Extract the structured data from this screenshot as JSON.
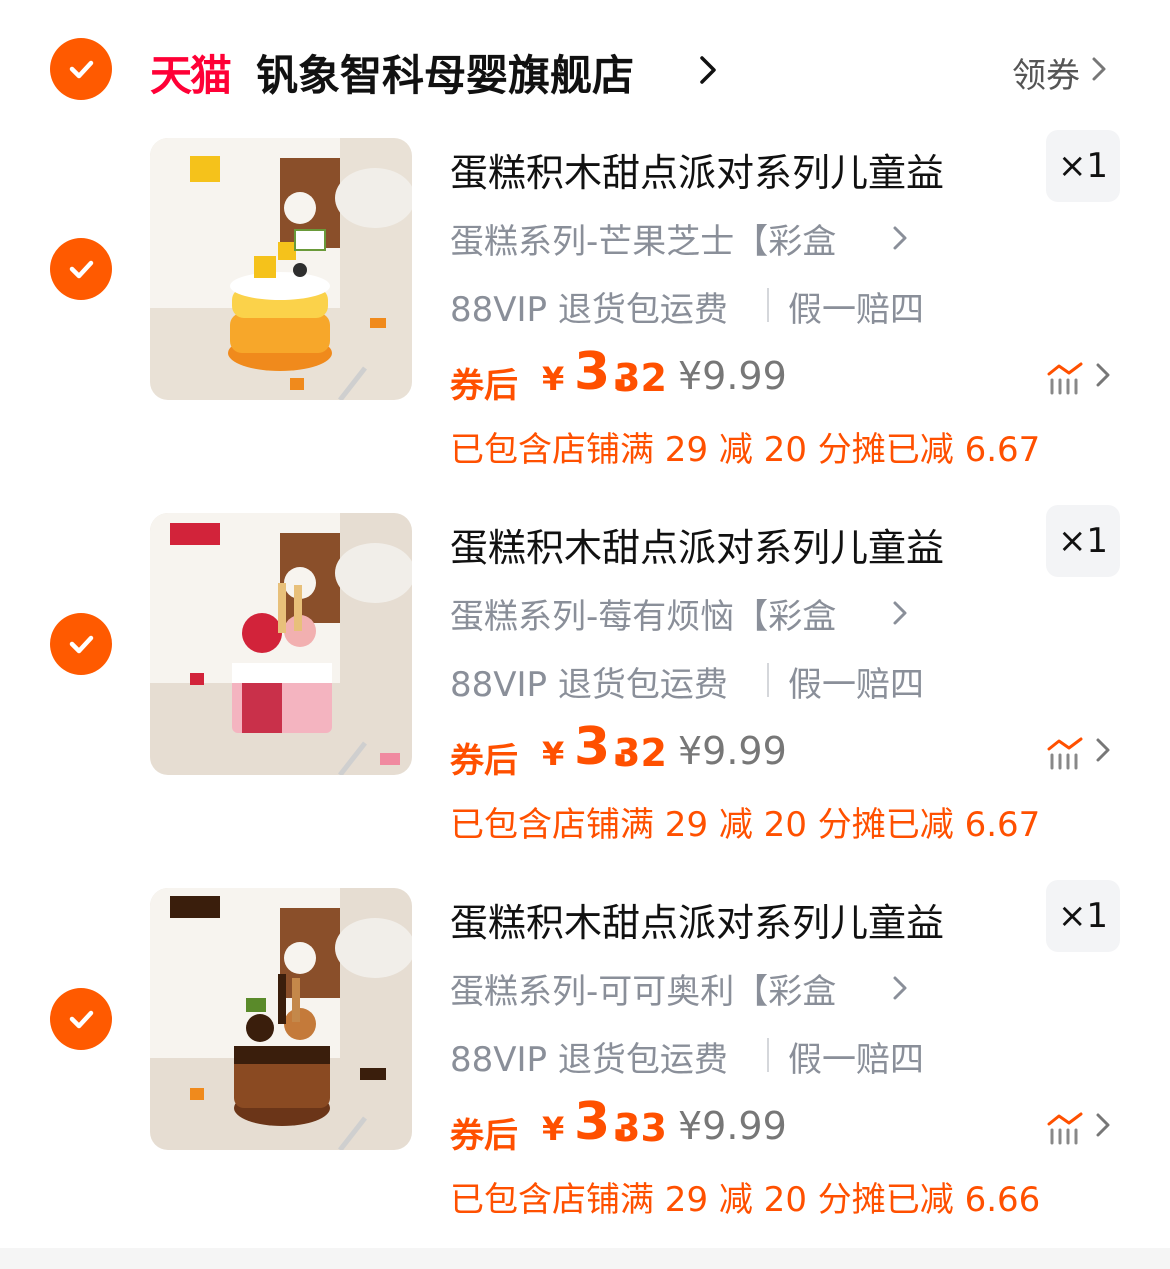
{
  "shop": {
    "brand": "天猫",
    "name": "钒象智科母婴旗舰店",
    "coupon_label": "领券",
    "checked": true
  },
  "colors": {
    "accent": "#ff5a00",
    "price": "#ff5000",
    "tmall": "#ff0036",
    "muted": "#8a8f99"
  },
  "items": [
    {
      "title": "蛋糕积木甜点派对系列儿童益",
      "spec": "蛋糕系列-芒果芝士【彩盒",
      "vip": "88VIP 退货包运费",
      "guarantee": "假一赔四",
      "qty": "×1",
      "after_label": "券后",
      "currency": "¥",
      "price_int": "3.",
      "price_dec": "32",
      "original_price": "¥9.99",
      "discount_note": "已包含店铺满 29 减 20 分摊已减 6.67",
      "image_icon": "mango-cheesecake-block-toy",
      "checked": true
    },
    {
      "title": "蛋糕积木甜点派对系列儿童益",
      "spec": "蛋糕系列-莓有烦恼【彩盒",
      "vip": "88VIP 退货包运费",
      "guarantee": "假一赔四",
      "qty": "×1",
      "after_label": "券后",
      "currency": "¥",
      "price_int": "3.",
      "price_dec": "32",
      "original_price": "¥9.99",
      "discount_note": "已包含店铺满 29 减 20 分摊已减 6.67",
      "image_icon": "strawberry-cake-block-toy",
      "checked": true
    },
    {
      "title": "蛋糕积木甜点派对系列儿童益",
      "spec": "蛋糕系列-可可奥利【彩盒",
      "vip": "88VIP 退货包运费",
      "guarantee": "假一赔四",
      "qty": "×1",
      "after_label": "券后",
      "currency": "¥",
      "price_int": "3.",
      "price_dec": "33",
      "original_price": "¥9.99",
      "discount_note": "已包含店铺满 29 减 20 分摊已减 6.66",
      "image_icon": "cocoa-oreo-cake-block-toy",
      "checked": true
    }
  ]
}
